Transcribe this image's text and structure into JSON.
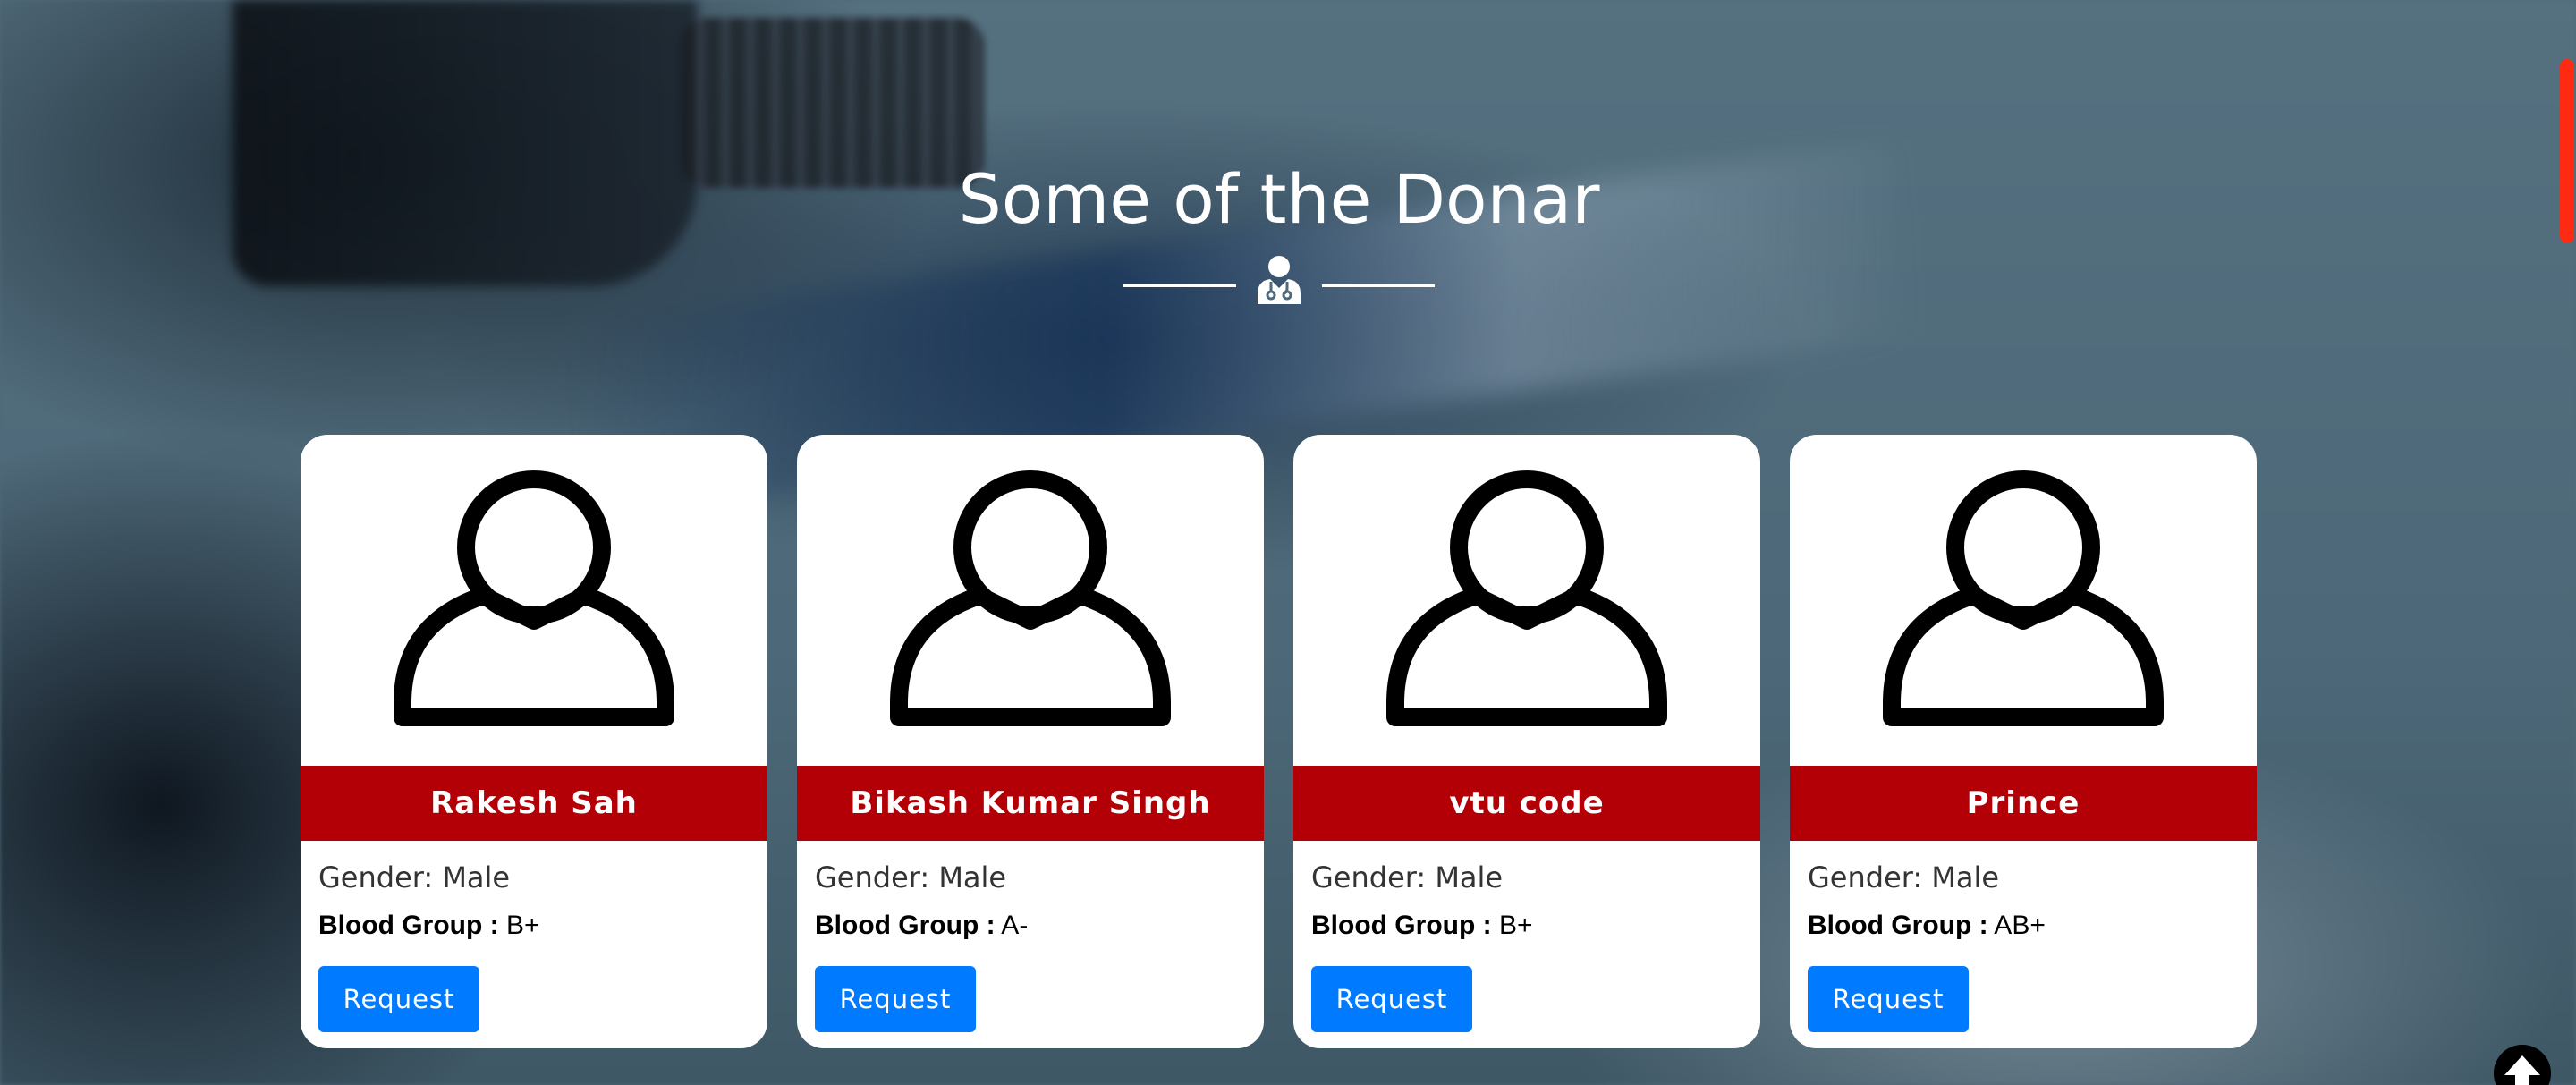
{
  "section": {
    "title": "Some of the Donar",
    "divider_icon": "doctor-icon"
  },
  "donors": [
    {
      "name": "Rakesh Sah",
      "gender": "Gender: Male",
      "blood_label": "Blood Group :",
      "blood_value": " B+",
      "button": "Request",
      "avatar_icon": "user-icon"
    },
    {
      "name": "Bikash Kumar Singh",
      "gender": "Gender: Male",
      "blood_label": "Blood Group :",
      "blood_value": " A-",
      "button": "Request",
      "avatar_icon": "user-icon"
    },
    {
      "name": "vtu code",
      "gender": "Gender: Male",
      "blood_label": "Blood Group :",
      "blood_value": " B+",
      "button": "Request",
      "avatar_icon": "user-icon"
    },
    {
      "name": "Prince",
      "gender": "Gender: Male",
      "blood_label": "Blood Group :",
      "blood_value": " AB+",
      "button": "Request",
      "avatar_icon": "user-icon"
    }
  ],
  "colors": {
    "name_bar": "#b30006",
    "button": "#007bff",
    "scrollbar": "#ff2a12"
  },
  "scroll_top_icon": "arrow-up-circle-icon"
}
